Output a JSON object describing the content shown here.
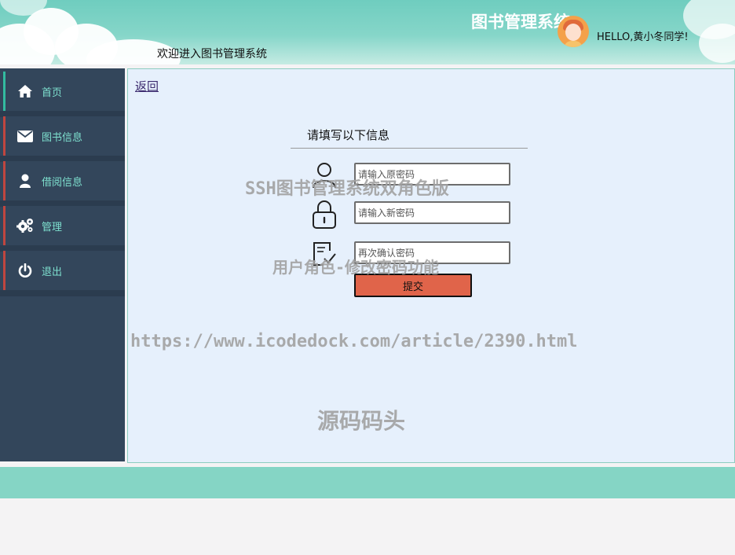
{
  "header": {
    "title": "图书管理系统",
    "welcome": "欢迎进入图书管理系统",
    "greeting": "HELLO,黄小冬同学!"
  },
  "sidebar": {
    "items": [
      {
        "label": "首页",
        "icon": "home-icon"
      },
      {
        "label": "图书信息",
        "icon": "envelope-icon"
      },
      {
        "label": "借阅信息",
        "icon": "user-icon"
      },
      {
        "label": "管理",
        "icon": "gears-icon"
      },
      {
        "label": "退出",
        "icon": "power-icon"
      }
    ]
  },
  "main": {
    "back_label": "返回",
    "form_title": "请填写以下信息",
    "fields": {
      "old_password_placeholder": "请输入原密码",
      "new_password_placeholder": "请输入新密码",
      "confirm_password_placeholder": "再次确认密码"
    },
    "submit_label": "提交"
  },
  "watermarks": {
    "line1": "SSH图书管理系统双角色版",
    "line2": "用户角色-修改密码功能",
    "line3": "https://www.icodedock.com/article/2390.html",
    "line4": "源码码头"
  },
  "colors": {
    "header": "#86d6c9",
    "sidebar": "#33465b",
    "nav_text": "#7ee0cf",
    "nav_border": "#c0463f",
    "main_bg": "#e6f0fc",
    "submit": "#e0644a",
    "footer": "#85d5c5"
  }
}
